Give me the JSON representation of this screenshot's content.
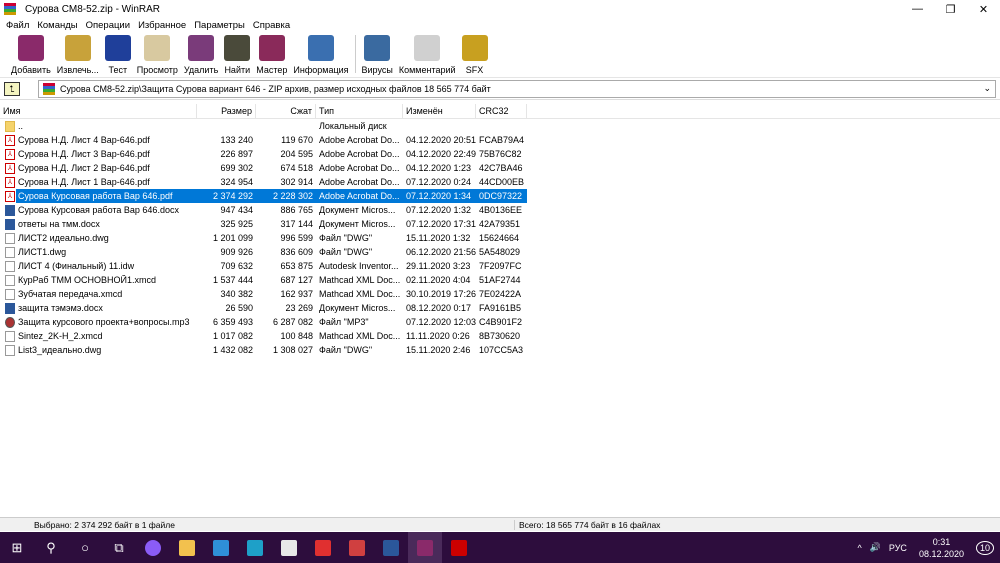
{
  "window": {
    "title": "Сурова СМ8-52.zip - WinRAR",
    "minimize": "—",
    "maximize": "❐",
    "close": "✕"
  },
  "menu": [
    "Файл",
    "Команды",
    "Операции",
    "Избранное",
    "Параметры",
    "Справка"
  ],
  "toolbar": [
    {
      "label": "Добавить",
      "icon": "add-archive-icon",
      "color": "#8a2a6a"
    },
    {
      "label": "Извлечь...",
      "icon": "extract-icon",
      "color": "#c8a23a"
    },
    {
      "label": "Тест",
      "icon": "test-icon",
      "color": "#1f3f9a"
    },
    {
      "label": "Просмотр",
      "icon": "view-icon",
      "color": "#d8c9a0"
    },
    {
      "label": "Удалить",
      "icon": "delete-icon",
      "color": "#7a3b7a"
    },
    {
      "label": "Найти",
      "icon": "find-icon",
      "color": "#4a4a3a"
    },
    {
      "label": "Мастер",
      "icon": "wizard-icon",
      "color": "#8a2a5a"
    },
    {
      "label": "Информация",
      "icon": "info-icon",
      "color": "#3a6fb0"
    },
    {
      "label": "Вирусы",
      "icon": "virus-scan-icon",
      "color": "#3a6aa0"
    },
    {
      "label": "Комментарий",
      "icon": "comment-icon",
      "color": "#d0d0d0"
    },
    {
      "label": "SFX",
      "icon": "sfx-icon",
      "color": "#c8a020"
    }
  ],
  "address": {
    "path": "Сурова СМ8-52.zip\\Защита Сурова вариант 646 - ZIP архив, размер исходных файлов 18 565 774 байт",
    "up": "⮤",
    "dropdown": "⌄"
  },
  "columns": [
    "Имя",
    "Размер",
    "Сжат",
    "Тип",
    "Изменён",
    "CRC32"
  ],
  "files": [
    {
      "name": "..",
      "size": "",
      "packed": "",
      "type": "Локальный диск",
      "modified": "",
      "crc": "",
      "icon": "folder"
    },
    {
      "name": "Сурова Н.Д. Лист 4 Вар-646.pdf",
      "size": "133 240",
      "packed": "119 670",
      "type": "Adobe Acrobat Do...",
      "modified": "04.12.2020 20:51",
      "crc": "FCAB79A4",
      "icon": "pdf"
    },
    {
      "name": "Сурова Н.Д. Лист 3 Вар-646.pdf",
      "size": "226 897",
      "packed": "204 595",
      "type": "Adobe Acrobat Do...",
      "modified": "04.12.2020 22:49",
      "crc": "75B76C82",
      "icon": "pdf"
    },
    {
      "name": "Сурова Н.Д. Лист 2 Вар-646.pdf",
      "size": "699 302",
      "packed": "674 518",
      "type": "Adobe Acrobat Do...",
      "modified": "04.12.2020 1:23",
      "crc": "42C7BA46",
      "icon": "pdf"
    },
    {
      "name": "Сурова Н.Д. Лист 1 Вар-646.pdf",
      "size": "324 954",
      "packed": "302 914",
      "type": "Adobe Acrobat Do...",
      "modified": "07.12.2020 0:24",
      "crc": "44CD00EB",
      "icon": "pdf"
    },
    {
      "name": "Сурова Курсовая работа Вар 646.pdf",
      "size": "2 374 292",
      "packed": "2 228 302",
      "type": "Adobe Acrobat Do...",
      "modified": "07.12.2020 1:34",
      "crc": "0DC97322",
      "icon": "pdf",
      "selected": true
    },
    {
      "name": "Сурова Курсовая работа Вар 646.docx",
      "size": "947 434",
      "packed": "886 765",
      "type": "Документ Micros...",
      "modified": "07.12.2020 1:32",
      "crc": "4B0136EE",
      "icon": "doc"
    },
    {
      "name": "ответы на тмм.docx",
      "size": "325 925",
      "packed": "317 144",
      "type": "Документ Micros...",
      "modified": "07.12.2020 17:31",
      "crc": "42A79351",
      "icon": "doc"
    },
    {
      "name": "ЛИСТ2 идеально.dwg",
      "size": "1 201 099",
      "packed": "996 599",
      "type": "Файл \"DWG\"",
      "modified": "15.11.2020 1:32",
      "crc": "15624664",
      "icon": "file"
    },
    {
      "name": "ЛИСТ1.dwg",
      "size": "909 926",
      "packed": "836 609",
      "type": "Файл \"DWG\"",
      "modified": "06.12.2020 21:56",
      "crc": "5A548029",
      "icon": "file"
    },
    {
      "name": "ЛИСТ 4 (Финальный) 11.idw",
      "size": "709 632",
      "packed": "653 875",
      "type": "Autodesk Inventor...",
      "modified": "29.11.2020 3:23",
      "crc": "7F2097FC",
      "icon": "file"
    },
    {
      "name": "КурРаб ТММ ОСНОВНОЙ1.xmcd",
      "size": "1 537 444",
      "packed": "687 127",
      "type": "Mathcad XML Doc...",
      "modified": "02.11.2020 4:04",
      "crc": "51AF2744",
      "icon": "file"
    },
    {
      "name": "Зубчатая передача.xmcd",
      "size": "340 382",
      "packed": "162 937",
      "type": "Mathcad XML Doc...",
      "modified": "30.10.2019 17:26",
      "crc": "7E02422A",
      "icon": "file"
    },
    {
      "name": "защита тэмэмэ.docx",
      "size": "26 590",
      "packed": "23 269",
      "type": "Документ Micros...",
      "modified": "08.12.2020 0:17",
      "crc": "FA9161B5",
      "icon": "doc"
    },
    {
      "name": "Защита курсового проекта+вопросы.mp3",
      "size": "6 359 493",
      "packed": "6 287 082",
      "type": "Файл \"MP3\"",
      "modified": "07.12.2020 12:03",
      "crc": "C4B901F2",
      "icon": "mp3"
    },
    {
      "name": "Sintez_2K-H_2.xmcd",
      "size": "1 017 082",
      "packed": "100 848",
      "type": "Mathcad XML Doc...",
      "modified": "11.11.2020 0:26",
      "crc": "8B730620",
      "icon": "file"
    },
    {
      "name": "List3_идеально.dwg",
      "size": "1 432 082",
      "packed": "1 308 027",
      "type": "Файл \"DWG\"",
      "modified": "15.11.2020 2:46",
      "crc": "107CC5A3",
      "icon": "file"
    }
  ],
  "status": {
    "selected": "Выбрано: 2 374 292 байт в 1 файле",
    "total": "Всего: 18 565 774 байт в 16 файлах"
  },
  "taskbar": {
    "apps": [
      {
        "name": "start",
        "glyph": "⊞",
        "color": ""
      },
      {
        "name": "search",
        "glyph": "⚲",
        "color": ""
      },
      {
        "name": "cortana",
        "glyph": "○",
        "color": ""
      },
      {
        "name": "task-view",
        "glyph": "⧉",
        "color": ""
      },
      {
        "name": "alice",
        "glyph": "",
        "color": "#8b5cf6"
      },
      {
        "name": "explorer",
        "glyph": "",
        "color": "#f2c14e"
      },
      {
        "name": "mail",
        "glyph": "",
        "color": "#2f8fd8"
      },
      {
        "name": "edge",
        "glyph": "",
        "color": "#1ea0c8"
      },
      {
        "name": "store",
        "glyph": "",
        "color": "#e8e8e8"
      },
      {
        "name": "yandex-browser",
        "glyph": "",
        "color": "#e03030"
      },
      {
        "name": "chrome",
        "glyph": "",
        "color": "#d04040"
      },
      {
        "name": "word",
        "glyph": "",
        "color": "#2b579a"
      },
      {
        "name": "winrar",
        "glyph": "",
        "color": "#8a2a6a"
      },
      {
        "name": "acrobat",
        "glyph": "",
        "color": "#c00"
      }
    ],
    "lang": "РУС",
    "time": "0:31",
    "date": "08.12.2020",
    "notifications": "10"
  }
}
